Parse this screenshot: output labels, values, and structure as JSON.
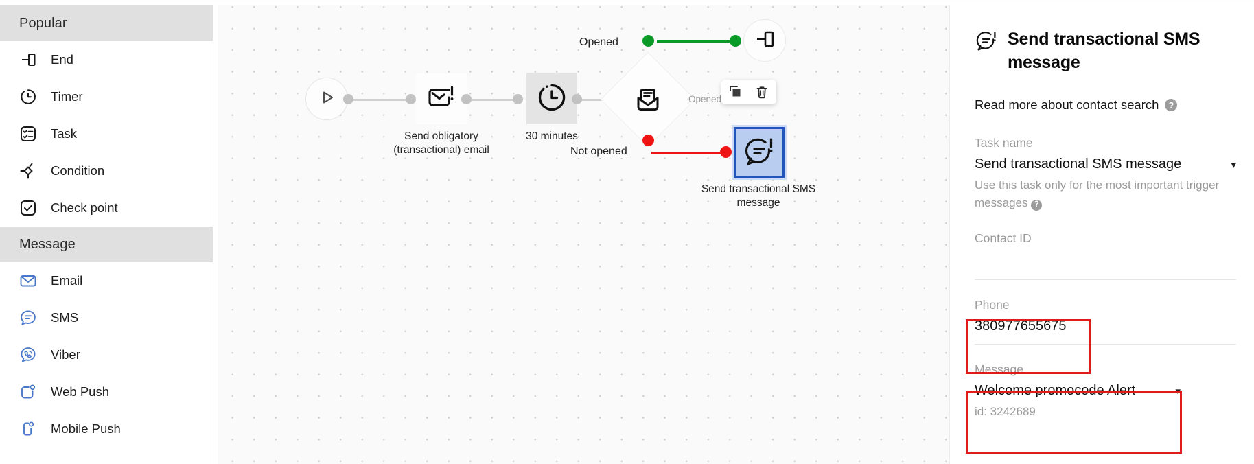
{
  "sidebar": {
    "groups": [
      {
        "title": "Popular",
        "items": [
          {
            "label": "End",
            "icon": "end-icon"
          },
          {
            "label": "Timer",
            "icon": "timer-icon"
          },
          {
            "label": "Task",
            "icon": "task-icon"
          },
          {
            "label": "Condition",
            "icon": "condition-icon"
          },
          {
            "label": "Check point",
            "icon": "check-point-icon"
          }
        ]
      },
      {
        "title": "Message",
        "items": [
          {
            "label": "Email",
            "icon": "email-icon"
          },
          {
            "label": "SMS",
            "icon": "sms-icon"
          },
          {
            "label": "Viber",
            "icon": "viber-icon"
          },
          {
            "label": "Web Push",
            "icon": "web-push-icon"
          },
          {
            "label": "Mobile Push",
            "icon": "mobile-push-icon"
          }
        ]
      }
    ]
  },
  "canvas": {
    "nodes": {
      "start": {
        "label": ""
      },
      "email": {
        "label": "Send obligatory\n(transactional) email"
      },
      "email_line1": "Send obligatory",
      "email_line2": "(transactional) email",
      "timer": {
        "label": "30 minutes"
      },
      "condition": {
        "label": "Opened?"
      },
      "end": {
        "label": ""
      },
      "sms_line1": "Send transactional SMS",
      "sms_line2": "message"
    },
    "branches": {
      "opened": "Opened",
      "not_opened": "Not opened"
    },
    "toolbar": {
      "copy_label": "copy",
      "delete_label": "delete"
    },
    "colors": {
      "opened": "#0a9a28",
      "not_opened": "#ee1414",
      "selected_border": "#2255bb",
      "selected_fill": "#b8cdf0"
    }
  },
  "panel": {
    "title": "Send transactional SMS message",
    "link_text": "Read more about contact search",
    "help_glyph": "?",
    "fields": [
      {
        "label": "Task name",
        "value": "Send transactional SMS message",
        "hint": "Use this task only for the most important trigger messages",
        "has_chevron": true,
        "has_hint_help": true
      },
      {
        "label": "Contact ID",
        "value": "",
        "hint": "",
        "has_chevron": false,
        "has_hint_help": false
      },
      {
        "label": "Phone",
        "value": "380977655675",
        "hint": "",
        "has_chevron": false,
        "has_hint_help": false,
        "highlighted": true
      },
      {
        "label": "Message",
        "value": "Welcome promocode Alert",
        "hint": "id: 3242689",
        "has_chevron": true,
        "has_hint_help": false,
        "highlighted": true
      }
    ],
    "highlight_color": "#e01b1b"
  }
}
